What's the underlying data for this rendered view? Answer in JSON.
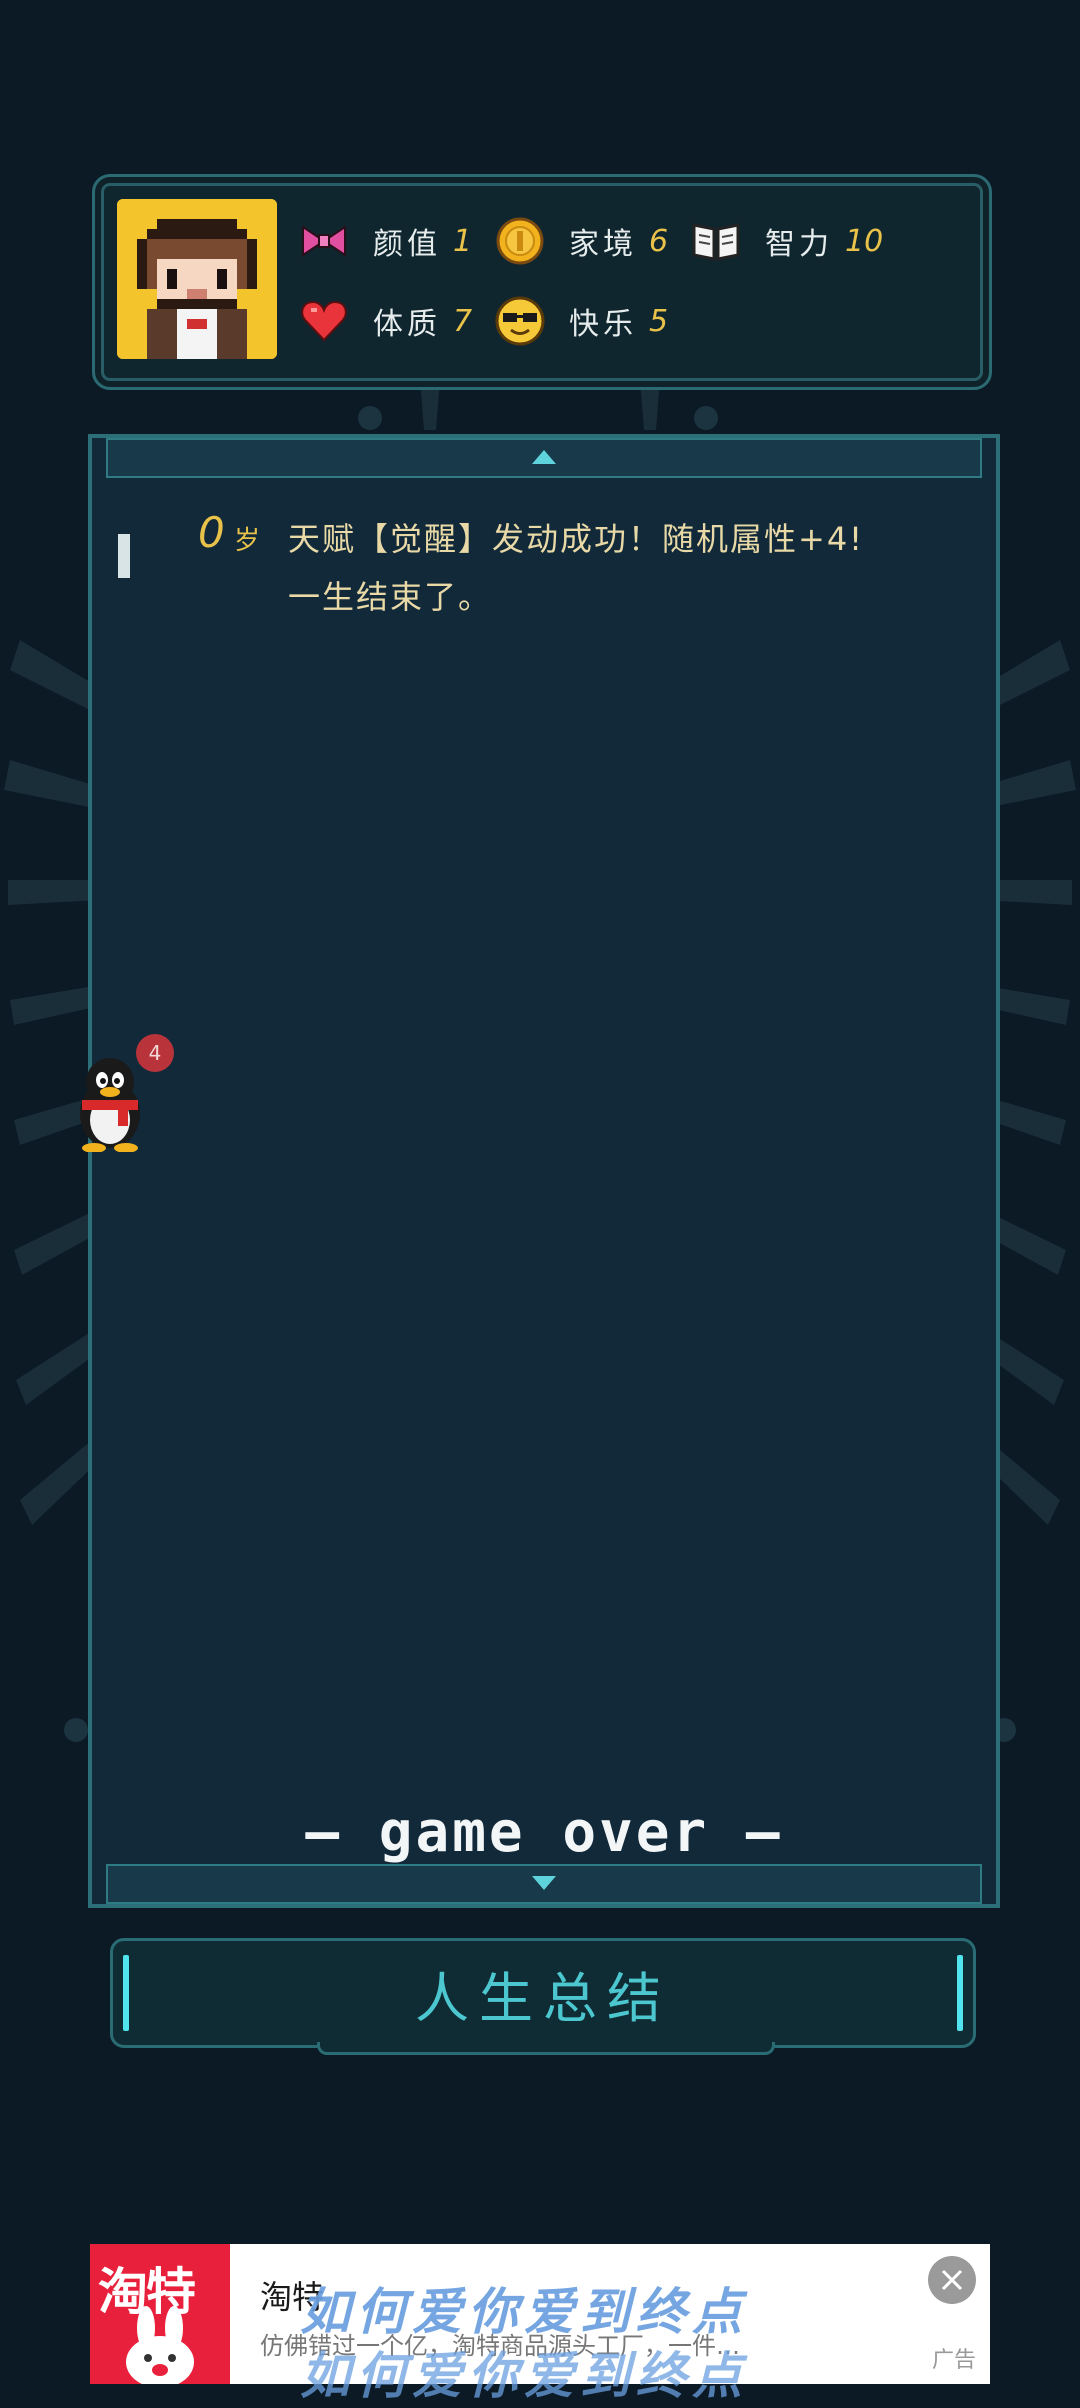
{
  "stats": [
    {
      "name": "颜值",
      "value": "1",
      "icon": "bow-icon"
    },
    {
      "name": "家境",
      "value": "6",
      "icon": "coin-icon"
    },
    {
      "name": "智力",
      "value": "10",
      "icon": "book-icon"
    },
    {
      "name": "体质",
      "value": "7",
      "icon": "heart-icon"
    },
    {
      "name": "快乐",
      "value": "5",
      "icon": "sunglasses-face-icon"
    }
  ],
  "log": {
    "age_number": "0",
    "age_unit": "岁",
    "lines": [
      "天赋【觉醒】发动成功！随机属性+4!",
      "一生结束了。"
    ]
  },
  "game_over": "— game over —",
  "qq": {
    "badge": "4"
  },
  "summary_button": "人生总结",
  "ad": {
    "title": "淘特",
    "description": "仿佛错过一个亿，淘特商品源头工厂，一件…",
    "label": "广告",
    "logo_text": "淘特",
    "overlay_text": "如何爱你爱到终点"
  },
  "colors": {
    "background": "#0b1a24",
    "panel": "#12293a",
    "accent_cyan": "#4cc7cf",
    "value_gold": "#e9c24a",
    "ad_red": "#e8203b"
  }
}
